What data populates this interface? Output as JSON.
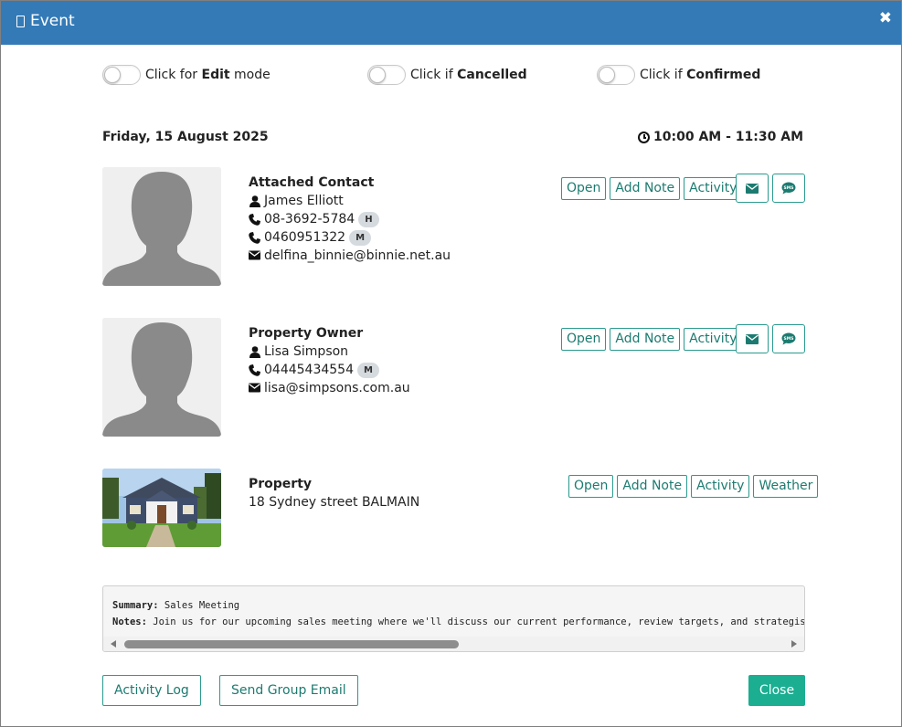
{
  "header": {
    "title": "Event"
  },
  "toggles": [
    {
      "prefix": "Click for",
      "bold": "Edit",
      "suffix": "mode"
    },
    {
      "prefix": "Click if",
      "bold": "Cancelled",
      "suffix": ""
    },
    {
      "prefix": "Click if",
      "bold": "Confirmed",
      "suffix": ""
    }
  ],
  "event": {
    "date": "Friday, 15 August 2025",
    "time": "10:00 AM - 11:30 AM"
  },
  "contact": {
    "heading": "Attached Contact",
    "name": "James Elliott",
    "phone1": "08-3692-5784",
    "phone1_badge": "H",
    "phone2": "0460951322",
    "phone2_badge": "M",
    "email": "delfina_binnie@binnie.net.au"
  },
  "owner": {
    "heading": "Property Owner",
    "name": "Lisa Simpson",
    "phone": "04445434554",
    "phone_badge": "M",
    "email": "lisa@simpsons.com.au"
  },
  "property": {
    "heading": "Property",
    "address": "18 Sydney street BALMAIN"
  },
  "buttons": {
    "open": "Open",
    "add_note": "Add Note",
    "activity": "Activity",
    "weather": "Weather",
    "sms": "SMS"
  },
  "summary": {
    "summary_label": "Summary:",
    "summary_value": "Sales Meeting",
    "notes_label": "Notes:",
    "notes_value": "Join us for our upcoming sales meeting where we'll discuss our current performance, review targets, and strategise for"
  },
  "footer": {
    "activity_log": "Activity Log",
    "send_group_email": "Send Group Email",
    "close": "Close"
  },
  "colors": {
    "header": "#337ab7",
    "accent": "#2a9a8e",
    "close_button": "#1bae91"
  }
}
